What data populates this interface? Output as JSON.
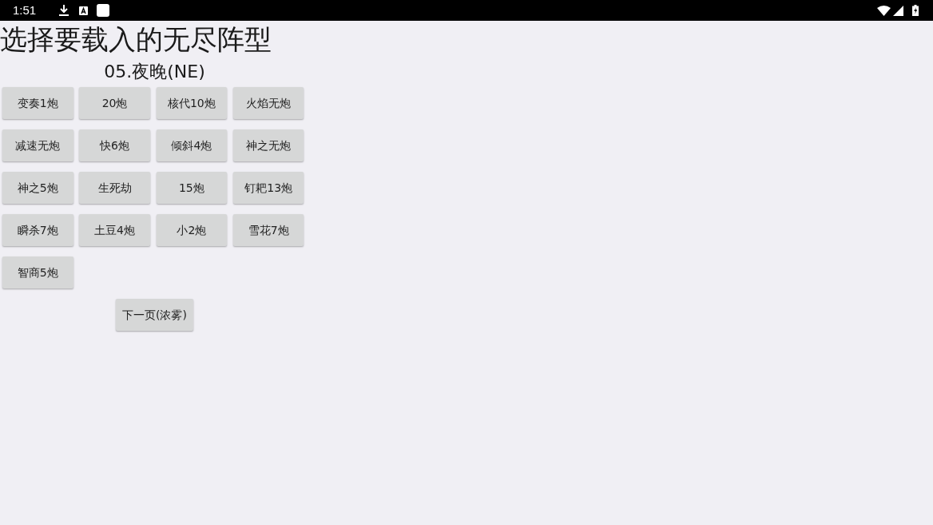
{
  "status_bar": {
    "time": "1:51"
  },
  "title": "选择要载入的无尽阵型",
  "subtitle": "05.夜晚(NE)",
  "formation_buttons": [
    "变奏1炮",
    "20炮",
    "核代10炮",
    "火焰无炮",
    "减速无炮",
    "快6炮",
    "倾斜4炮",
    "神之无炮",
    "神之5炮",
    "生死劫",
    "15炮",
    "钉耙13炮",
    "瞬杀7炮",
    "土豆4炮",
    "小2炮",
    "雪花7炮",
    "智商5炮"
  ],
  "next_button": "下一页(浓雾)"
}
